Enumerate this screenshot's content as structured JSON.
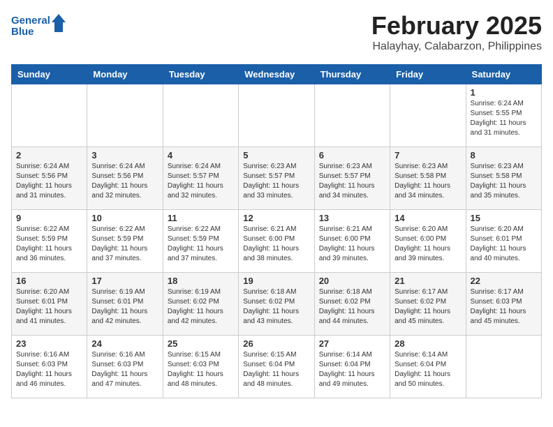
{
  "header": {
    "logo_line1": "General",
    "logo_line2": "Blue",
    "title": "February 2025",
    "subtitle": "Halayhay, Calabarzon, Philippines"
  },
  "calendar": {
    "days_of_week": [
      "Sunday",
      "Monday",
      "Tuesday",
      "Wednesday",
      "Thursday",
      "Friday",
      "Saturday"
    ],
    "weeks": [
      [
        {
          "day": "",
          "info": ""
        },
        {
          "day": "",
          "info": ""
        },
        {
          "day": "",
          "info": ""
        },
        {
          "day": "",
          "info": ""
        },
        {
          "day": "",
          "info": ""
        },
        {
          "day": "",
          "info": ""
        },
        {
          "day": "1",
          "info": "Sunrise: 6:24 AM\nSunset: 5:55 PM\nDaylight: 11 hours\nand 31 minutes."
        }
      ],
      [
        {
          "day": "2",
          "info": "Sunrise: 6:24 AM\nSunset: 5:56 PM\nDaylight: 11 hours\nand 31 minutes."
        },
        {
          "day": "3",
          "info": "Sunrise: 6:24 AM\nSunset: 5:56 PM\nDaylight: 11 hours\nand 32 minutes."
        },
        {
          "day": "4",
          "info": "Sunrise: 6:24 AM\nSunset: 5:57 PM\nDaylight: 11 hours\nand 32 minutes."
        },
        {
          "day": "5",
          "info": "Sunrise: 6:23 AM\nSunset: 5:57 PM\nDaylight: 11 hours\nand 33 minutes."
        },
        {
          "day": "6",
          "info": "Sunrise: 6:23 AM\nSunset: 5:57 PM\nDaylight: 11 hours\nand 34 minutes."
        },
        {
          "day": "7",
          "info": "Sunrise: 6:23 AM\nSunset: 5:58 PM\nDaylight: 11 hours\nand 34 minutes."
        },
        {
          "day": "8",
          "info": "Sunrise: 6:23 AM\nSunset: 5:58 PM\nDaylight: 11 hours\nand 35 minutes."
        }
      ],
      [
        {
          "day": "9",
          "info": "Sunrise: 6:22 AM\nSunset: 5:59 PM\nDaylight: 11 hours\nand 36 minutes."
        },
        {
          "day": "10",
          "info": "Sunrise: 6:22 AM\nSunset: 5:59 PM\nDaylight: 11 hours\nand 37 minutes."
        },
        {
          "day": "11",
          "info": "Sunrise: 6:22 AM\nSunset: 5:59 PM\nDaylight: 11 hours\nand 37 minutes."
        },
        {
          "day": "12",
          "info": "Sunrise: 6:21 AM\nSunset: 6:00 PM\nDaylight: 11 hours\nand 38 minutes."
        },
        {
          "day": "13",
          "info": "Sunrise: 6:21 AM\nSunset: 6:00 PM\nDaylight: 11 hours\nand 39 minutes."
        },
        {
          "day": "14",
          "info": "Sunrise: 6:20 AM\nSunset: 6:00 PM\nDaylight: 11 hours\nand 39 minutes."
        },
        {
          "day": "15",
          "info": "Sunrise: 6:20 AM\nSunset: 6:01 PM\nDaylight: 11 hours\nand 40 minutes."
        }
      ],
      [
        {
          "day": "16",
          "info": "Sunrise: 6:20 AM\nSunset: 6:01 PM\nDaylight: 11 hours\nand 41 minutes."
        },
        {
          "day": "17",
          "info": "Sunrise: 6:19 AM\nSunset: 6:01 PM\nDaylight: 11 hours\nand 42 minutes."
        },
        {
          "day": "18",
          "info": "Sunrise: 6:19 AM\nSunset: 6:02 PM\nDaylight: 11 hours\nand 42 minutes."
        },
        {
          "day": "19",
          "info": "Sunrise: 6:18 AM\nSunset: 6:02 PM\nDaylight: 11 hours\nand 43 minutes."
        },
        {
          "day": "20",
          "info": "Sunrise: 6:18 AM\nSunset: 6:02 PM\nDaylight: 11 hours\nand 44 minutes."
        },
        {
          "day": "21",
          "info": "Sunrise: 6:17 AM\nSunset: 6:02 PM\nDaylight: 11 hours\nand 45 minutes."
        },
        {
          "day": "22",
          "info": "Sunrise: 6:17 AM\nSunset: 6:03 PM\nDaylight: 11 hours\nand 45 minutes."
        }
      ],
      [
        {
          "day": "23",
          "info": "Sunrise: 6:16 AM\nSunset: 6:03 PM\nDaylight: 11 hours\nand 46 minutes."
        },
        {
          "day": "24",
          "info": "Sunrise: 6:16 AM\nSunset: 6:03 PM\nDaylight: 11 hours\nand 47 minutes."
        },
        {
          "day": "25",
          "info": "Sunrise: 6:15 AM\nSunset: 6:03 PM\nDaylight: 11 hours\nand 48 minutes."
        },
        {
          "day": "26",
          "info": "Sunrise: 6:15 AM\nSunset: 6:04 PM\nDaylight: 11 hours\nand 48 minutes."
        },
        {
          "day": "27",
          "info": "Sunrise: 6:14 AM\nSunset: 6:04 PM\nDaylight: 11 hours\nand 49 minutes."
        },
        {
          "day": "28",
          "info": "Sunrise: 6:14 AM\nSunset: 6:04 PM\nDaylight: 11 hours\nand 50 minutes."
        },
        {
          "day": "",
          "info": ""
        }
      ]
    ]
  }
}
